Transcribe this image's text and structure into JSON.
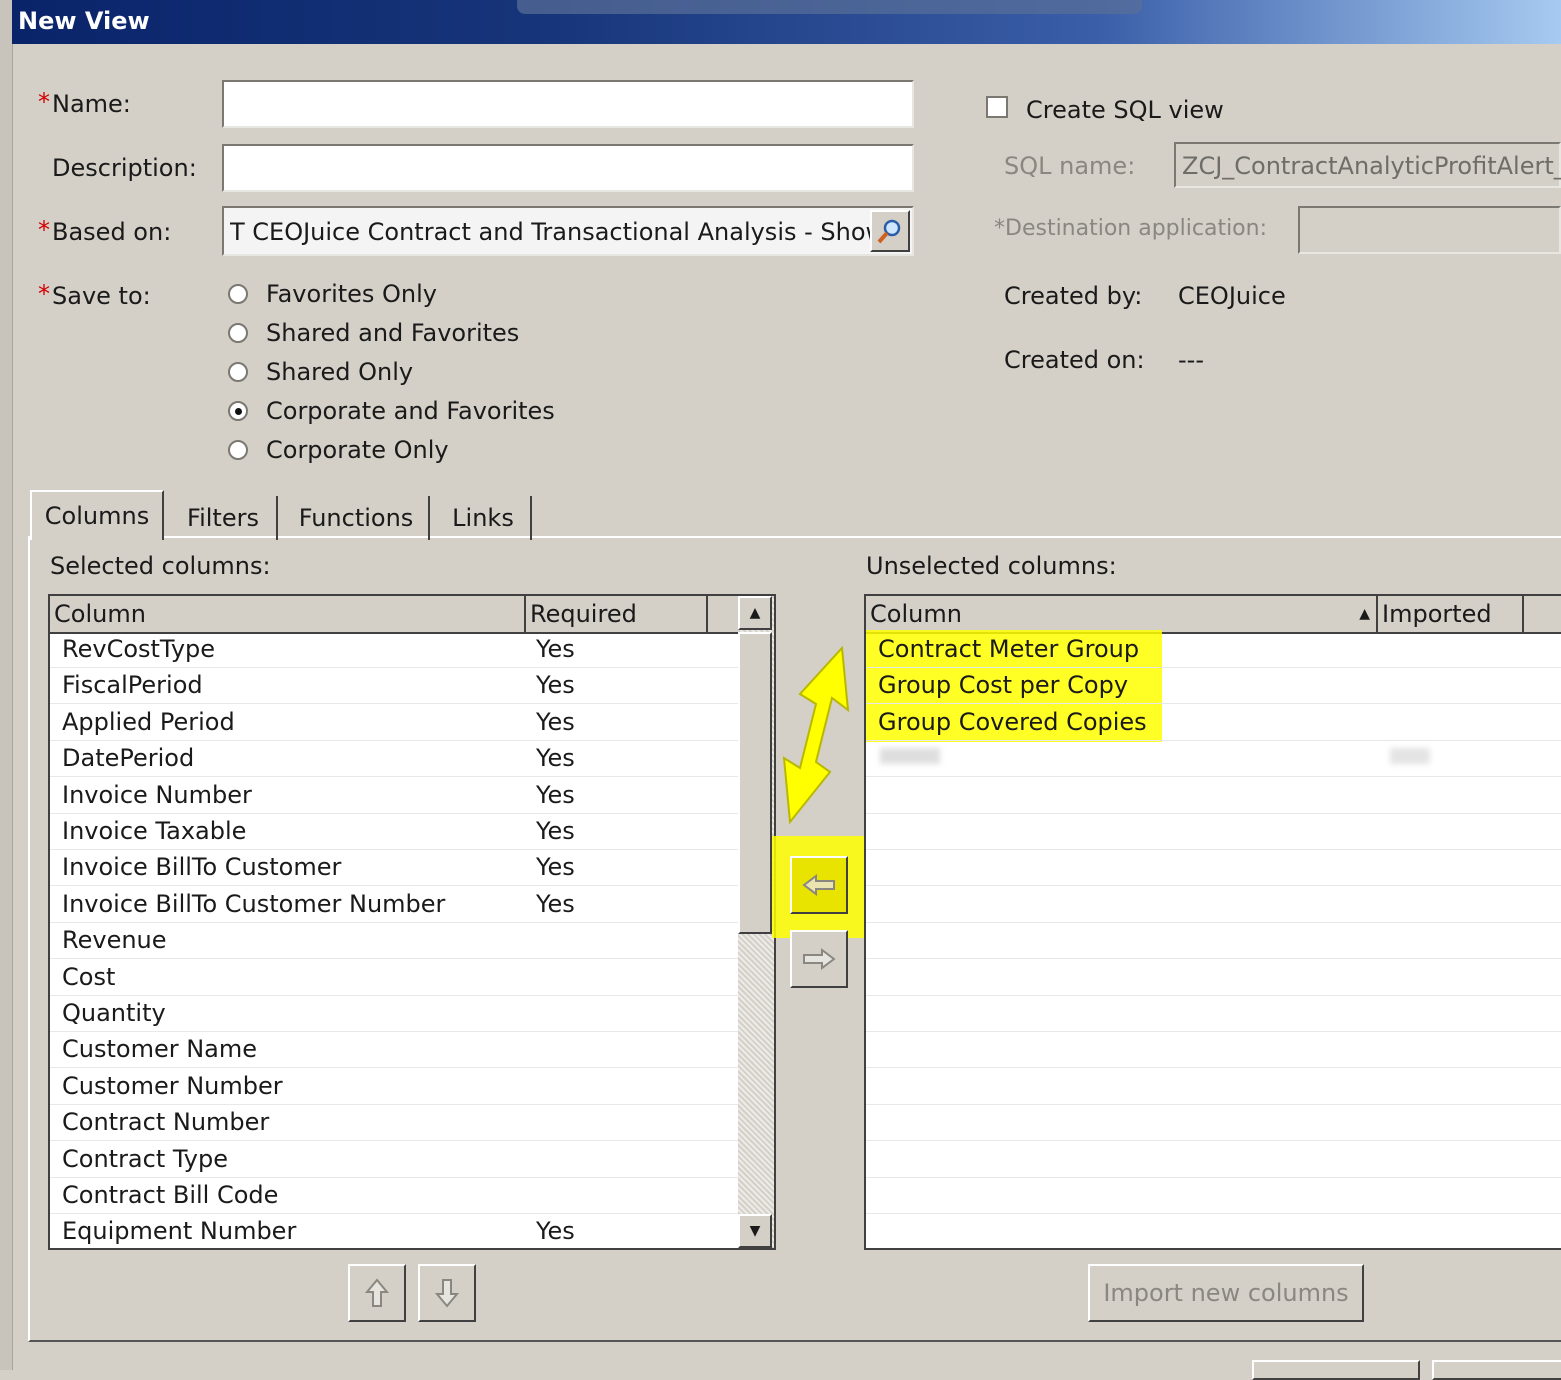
{
  "window": {
    "title": "New View"
  },
  "form": {
    "name_label": "Name:",
    "name_value": "",
    "description_label": "Description:",
    "description_value": "",
    "based_on_label": "Based on:",
    "based_on_value": "T CEOJuice Contract and Transactional Analysis - Shows",
    "save_to_label": "Save to:",
    "required_marker": "*",
    "save_options": [
      {
        "label": "Favorites Only",
        "checked": false
      },
      {
        "label": "Shared and Favorites",
        "checked": false
      },
      {
        "label": "Shared Only",
        "checked": false
      },
      {
        "label": "Corporate and Favorites",
        "checked": true
      },
      {
        "label": "Corporate Only",
        "checked": false
      }
    ]
  },
  "sql": {
    "create_label": "Create SQL view",
    "checked": false,
    "name_label": "SQL name:",
    "name_value": "ZCJ_ContractAnalyticProfitAlert_RI",
    "dest_label": "*Destination application:",
    "dest_value": ""
  },
  "meta": {
    "created_by_label": "Created by:",
    "created_by_value": "CEOJuice",
    "created_on_label": "Created on:",
    "created_on_value": "---"
  },
  "tabs": [
    {
      "label": "Columns",
      "active": true
    },
    {
      "label": "Filters",
      "active": false
    },
    {
      "label": "Functions",
      "active": false
    },
    {
      "label": "Links",
      "active": false
    }
  ],
  "selected": {
    "label": "Selected columns:",
    "headers": [
      "Column",
      "Required"
    ],
    "rows": [
      [
        "RevCostType",
        "Yes"
      ],
      [
        "FiscalPeriod",
        "Yes"
      ],
      [
        "Applied Period",
        "Yes"
      ],
      [
        "DatePeriod",
        "Yes"
      ],
      [
        "Invoice Number",
        "Yes"
      ],
      [
        "Invoice Taxable",
        "Yes"
      ],
      [
        "Invoice BillTo Customer",
        "Yes"
      ],
      [
        "Invoice BillTo Customer Number",
        "Yes"
      ],
      [
        "Revenue",
        ""
      ],
      [
        "Cost",
        ""
      ],
      [
        "Quantity",
        ""
      ],
      [
        "Customer Name",
        ""
      ],
      [
        "Customer Number",
        ""
      ],
      [
        "Contract Number",
        ""
      ],
      [
        "Contract Type",
        ""
      ],
      [
        "Contract Bill Code",
        ""
      ],
      [
        "Equipment Number",
        "Yes"
      ]
    ]
  },
  "unselected": {
    "label": "Unselected columns:",
    "headers": [
      "Column",
      "Imported"
    ],
    "rows": [
      [
        "Contract Meter Group",
        ""
      ],
      [
        "Group Cost per Copy",
        ""
      ],
      [
        "Group Covered Copies",
        ""
      ]
    ]
  },
  "buttons": {
    "import_label": "Import new columns"
  },
  "colors": {
    "highlight": "#ffff00",
    "title_bar": "#0a246a",
    "dialog_bg": "#d4d0c8"
  }
}
